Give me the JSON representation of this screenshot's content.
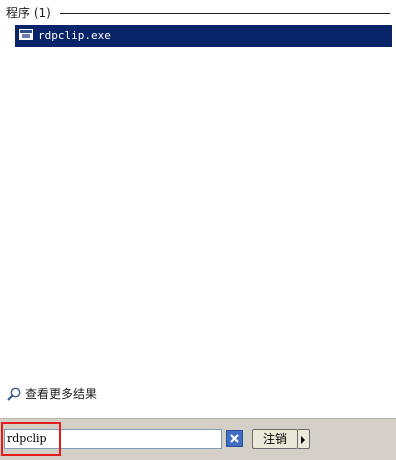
{
  "results": {
    "section_title": "程序 (1)",
    "items": [
      {
        "label": "rdpclip.exe",
        "icon": "application-window-icon"
      }
    ],
    "see_more_label": "查看更多结果",
    "see_more_icon": "search-magnifier-icon"
  },
  "search": {
    "value": "rdpclip",
    "clear_icon": "close-x-icon"
  },
  "logoff": {
    "label": "注销",
    "arrow_icon": "right-arrow-icon"
  },
  "colors": {
    "selection": "#0a246a",
    "highlight_box": "#e41c1c",
    "bottom_bar": "#d4d0c8"
  }
}
